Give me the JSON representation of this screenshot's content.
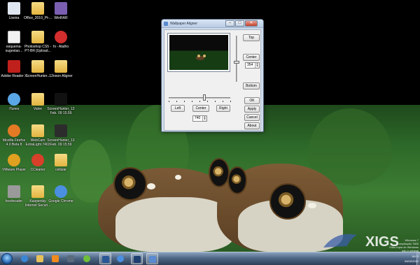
{
  "desktop": {
    "icons": [
      {
        "label": "Lixeira",
        "icon": "recycle-bin-icon",
        "color": "#dfe6ef"
      },
      {
        "label": "Office_2010_Pt-...",
        "icon": "folder-icon",
        "color": "#e8c15a"
      },
      {
        "label": "WinRAR",
        "icon": "winrar-icon",
        "color": "#7a5fb0"
      },
      {
        "label": "esquema-sugestao...",
        "icon": "document-icon",
        "color": "#ffffff"
      },
      {
        "label": "Photoshop CS5 - PT-BR [Upload...",
        "icon": "folder-icon",
        "color": "#e8c15a"
      },
      {
        "label": "hi - Atalho",
        "icon": "shortcut-icon",
        "color": "#d32d2d"
      },
      {
        "label": "Adobe Reader X",
        "icon": "adobe-reader-icon",
        "color": "#c0201b"
      },
      {
        "label": "ScreenHunter...",
        "icon": "folder-icon",
        "color": "#e8c15a"
      },
      {
        "label": "12noon Aligner",
        "icon": "folder-icon",
        "color": "#e8c15a"
      },
      {
        "label": "iTunes",
        "icon": "itunes-icon",
        "color": "#5aa6e6"
      },
      {
        "label": "Valve",
        "icon": "folder-icon",
        "color": "#e8c15a"
      },
      {
        "label": "ScreenHunter_12 Feb. 09 15.59",
        "icon": "screenshot-icon",
        "color": "#111111"
      },
      {
        "label": "Mozilla Firefox 4.0 Beta 8",
        "icon": "firefox-icon",
        "color": "#e57a25"
      },
      {
        "label": "WebCam ExtraLight 7403",
        "icon": "folder-icon",
        "color": "#e8c15a"
      },
      {
        "label": "ScreenHunter_13 Feb. 09 15.59",
        "icon": "screenshot-icon",
        "color": "#2c2c2c"
      },
      {
        "label": "VMware Player",
        "icon": "vmware-icon",
        "color": "#e0a020"
      },
      {
        "label": "CCleaner",
        "icon": "ccleaner-icon",
        "color": "#d8402a"
      },
      {
        "label": "cellular",
        "icon": "folder-icon",
        "color": "#e8c15a"
      },
      {
        "label": "feedreader",
        "icon": "feedreader-icon",
        "color": "#9a9a9a"
      },
      {
        "label": "Kaspersky Internet Securi...",
        "icon": "folder-icon",
        "color": "#e8c15a"
      },
      {
        "label": "Google Chrome",
        "icon": "chrome-icon",
        "color": "#4a8fe0"
      }
    ]
  },
  "window": {
    "title": "Wallpaper Aligner",
    "minimize_glyph": "–",
    "maximize_glyph": "□",
    "close_glyph": "✕",
    "buttons": {
      "top": "Top",
      "center_v": "Center",
      "bottom": "Bottom",
      "left": "Left",
      "center_h": "Center",
      "right": "Right",
      "ok": "OK",
      "apply": "Apply",
      "cancel": "Cancel",
      "about": "About"
    },
    "vertical_offset": "354",
    "horizontal_offset": "740",
    "spin_up": "▲",
    "spin_down": "▼",
    "horizontal_slider_fraction": 0.58,
    "vertical_slider_fraction": 0.58
  },
  "taskbar": {
    "pinned": [
      {
        "icon": "internet-explorer-icon",
        "color": "#3a86d6",
        "active": false
      },
      {
        "icon": "explorer-folder-icon",
        "color": "#e8c15a",
        "active": false
      },
      {
        "icon": "media-player-icon",
        "color": "#f08a1c",
        "active": false
      },
      {
        "icon": "screenhunter-icon",
        "color": "#5a6b7d",
        "active": false
      },
      {
        "icon": "windows-media-center-icon",
        "color": "#6fbf3a",
        "active": false
      },
      {
        "icon": "word-icon",
        "color": "#2b5797",
        "active": true
      },
      {
        "icon": "chrome-icon",
        "color": "#4a8fe0",
        "active": false
      },
      {
        "icon": "photoshop-icon",
        "color": "#1e3e70",
        "active": true
      },
      {
        "icon": "wallpaper-aligner-icon",
        "color": "#5a8bd0",
        "active": true
      }
    ],
    "tray": {
      "time": "16:00",
      "date": "09/02/2012"
    }
  },
  "watermark": {
    "brand": "XIGS",
    "build_lines": [
      "Windows 7",
      "Compilação 7600",
      "Esta cópia do Windows não é original"
    ]
  }
}
